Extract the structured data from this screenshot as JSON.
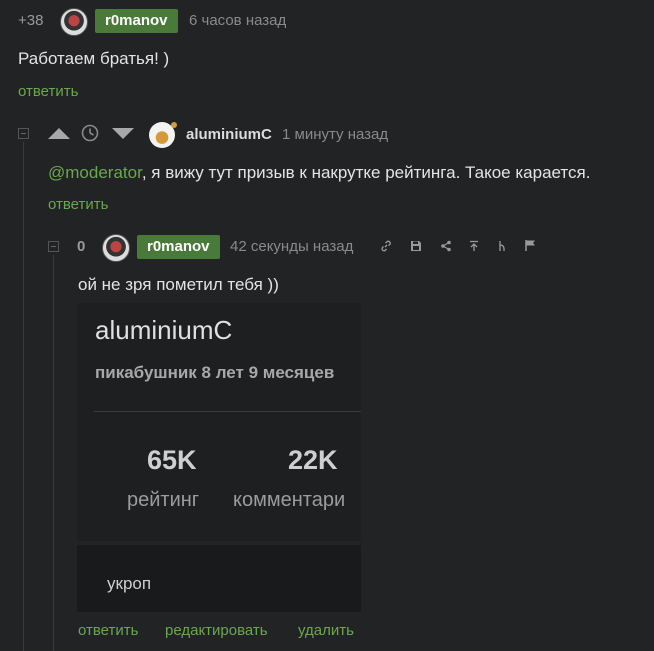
{
  "comment1": {
    "rating": "+38",
    "username": "r0manov",
    "time": "6 часов назад",
    "text": "Работаем братья! )",
    "reply": "ответить"
  },
  "comment2": {
    "username": "aluminiumC",
    "time": "1 минуту назад",
    "mention": "@moderator",
    "text": ", я вижу тут призыв к накрутке рейтинга. Такое карается.",
    "reply": "ответить"
  },
  "comment3": {
    "rating": "0",
    "username": "r0manov",
    "time": "42 секунды назад",
    "text": "ой не зря пометил тебя ))",
    "actions": {
      "reply": "ответить",
      "edit": "редактировать",
      "delete": "удалить"
    }
  },
  "profile_card": {
    "name": "aluminiumC",
    "subtitle": "пикабушник 8 лет 9 месяцев",
    "stat1_value": "65K",
    "stat1_label": "рейтинг",
    "stat2_value": "22K",
    "stat2_label": "комментари",
    "note": "укроп"
  },
  "icons": [
    "collapse-icon",
    "upvote-icon",
    "clock-icon",
    "downvote-icon",
    "link-icon",
    "save-icon",
    "share-icon",
    "jump-up-icon",
    "branch-icon",
    "flag-icon"
  ],
  "colors": {
    "background": "#222324",
    "accent_green": "#6aa84f",
    "badge_green": "#4a7a3a"
  }
}
